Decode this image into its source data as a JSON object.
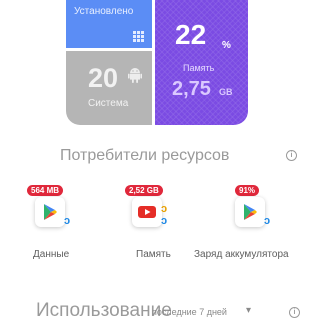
{
  "tiles": {
    "installed_label": "Установлено",
    "system_value": "20",
    "system_label": "Система",
    "memory_percent": "22",
    "memory_percent_sign": "%",
    "memory_label": "Память",
    "memory_value": "2,75",
    "memory_unit": "GB"
  },
  "consumers": {
    "title": "Потребители ресурсов",
    "info_glyph": "i",
    "items": [
      {
        "badge": "564 MB",
        "label": "Данные",
        "icon": "play-store-icon"
      },
      {
        "badge": "2,52 GB",
        "label": "Память",
        "icon": "youtube-icon"
      },
      {
        "badge": "91%",
        "label": "Заряд аккумулятора",
        "icon": "play-store-icon"
      }
    ]
  },
  "usage": {
    "title": "Использование",
    "period": "последние 7 дней",
    "chevron": "▾",
    "info_glyph": "i"
  },
  "colors": {
    "installed": "#5b8df5",
    "system": "#b5b5b5",
    "memory": "#7b4be3",
    "badge": "#e0283b"
  }
}
